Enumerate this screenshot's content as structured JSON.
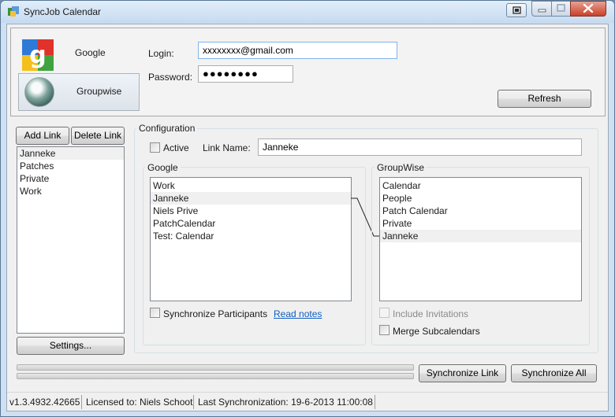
{
  "window": {
    "title": "SyncJob Calendar",
    "icon": "calendar-sync-icon"
  },
  "accounts": {
    "tabs": [
      {
        "label": "Google",
        "icon": "google-logo-icon"
      },
      {
        "label": "Groupwise",
        "icon": "groupwise-logo-icon"
      }
    ],
    "login_label": "Login:",
    "login_value": "xxxxxxxx@gmail.com",
    "password_label": "Password:",
    "password_value": "●●●●●●●●",
    "refresh_label": "Refresh"
  },
  "links": {
    "add_label": "Add Link",
    "delete_label": "Delete Link",
    "items": [
      "Janneke",
      "Patches",
      "Private",
      "Work"
    ],
    "settings_label": "Settings..."
  },
  "configuration": {
    "title": "Configuration",
    "active_label": "Active",
    "active_checked": false,
    "link_name_label": "Link Name:",
    "link_name_value": "Janneke",
    "google": {
      "title": "Google",
      "items": [
        "Work",
        "Janneke",
        "Niels Prive",
        "PatchCalendar",
        "Test: Calendar"
      ],
      "selected": "Janneke",
      "sync_participants_label": "Synchronize Participants",
      "read_notes_label": "Read notes"
    },
    "groupwise": {
      "title": "GroupWise",
      "items": [
        "Calendar",
        "People",
        "Patch Calendar",
        "Private",
        "Janneke"
      ],
      "selected": "Janneke",
      "include_invitations_label": "Include Invitations",
      "merge_subcalendars_label": "Merge Subcalendars"
    }
  },
  "actions": {
    "sync_link_label": "Synchronize Link",
    "sync_all_label": "Synchronize All"
  },
  "status": {
    "version": "v1.3.4932.42665",
    "license": "Licensed to: Niels Schoot",
    "last_sync": "Last Synchronization: 19-6-2013 11:00:08"
  },
  "colors": {
    "link": "#0f5fc4",
    "window_frame": "#cfe0f2",
    "close_button": "#c7412a"
  }
}
